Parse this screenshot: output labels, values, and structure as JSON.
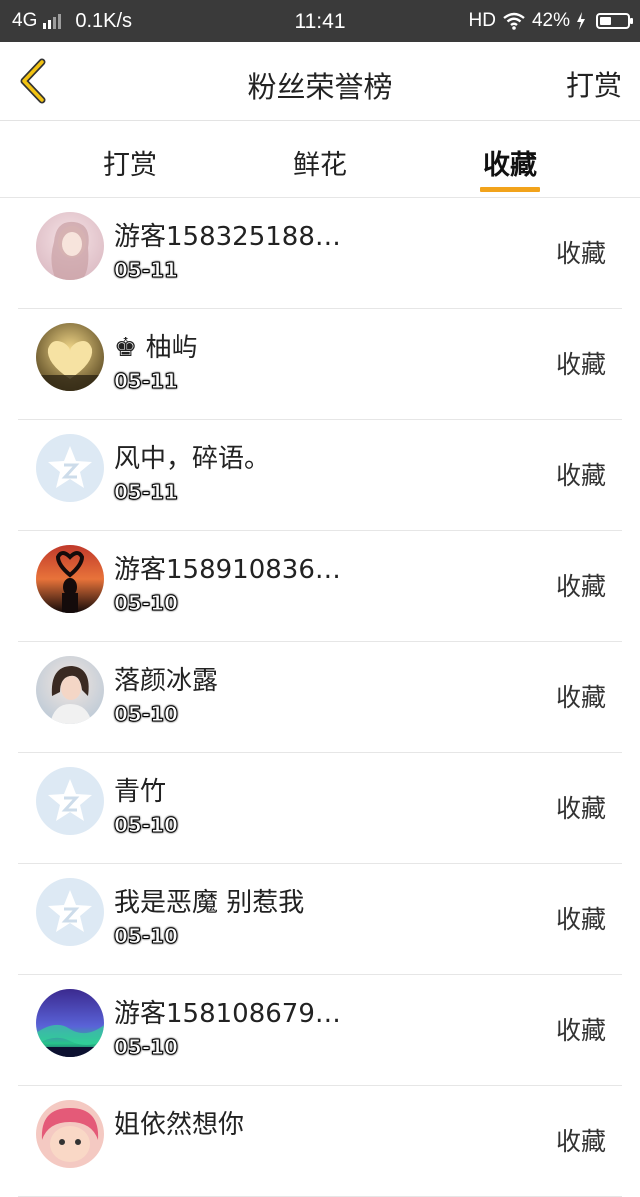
{
  "status_bar": {
    "network": "4G",
    "speed": "0.1K/s",
    "time": "11:41",
    "hd": "HD",
    "battery": "42%",
    "battery_level": 0.42
  },
  "header": {
    "title": "粉丝荣誉榜",
    "action": "打赏",
    "back_icon": "chevron-left-icon",
    "accent_color": "#f2a31b"
  },
  "tabs": [
    {
      "label": "打赏",
      "active": false
    },
    {
      "label": "鲜花",
      "active": false
    },
    {
      "label": "收藏",
      "active": true
    }
  ],
  "rows": [
    {
      "name": "游客158325188…",
      "date": "05-11",
      "action": "收藏",
      "avatar": "photo-girl"
    },
    {
      "name": "♚ 柚屿",
      "date": "05-11",
      "action": "收藏",
      "avatar": "photo-heart"
    },
    {
      "name": "风中，碎语。",
      "date": "05-11",
      "action": "收藏",
      "avatar": "default-star"
    },
    {
      "name": "游客158910836…",
      "date": "05-10",
      "action": "收藏",
      "avatar": "photo-sunset-heart"
    },
    {
      "name": "落颜冰露",
      "date": "05-10",
      "action": "收藏",
      "avatar": "photo-woman"
    },
    {
      "name": "青竹",
      "date": "05-10",
      "action": "收藏",
      "avatar": "default-star"
    },
    {
      "name": "我是恶魔 别惹我",
      "date": "05-10",
      "action": "收藏",
      "avatar": "default-star"
    },
    {
      "name": "游客158108679…",
      "date": "05-10",
      "action": "收藏",
      "avatar": "photo-aurora"
    },
    {
      "name": "姐依然想你",
      "date": "",
      "action": "收藏",
      "avatar": "photo-cartoon"
    }
  ]
}
